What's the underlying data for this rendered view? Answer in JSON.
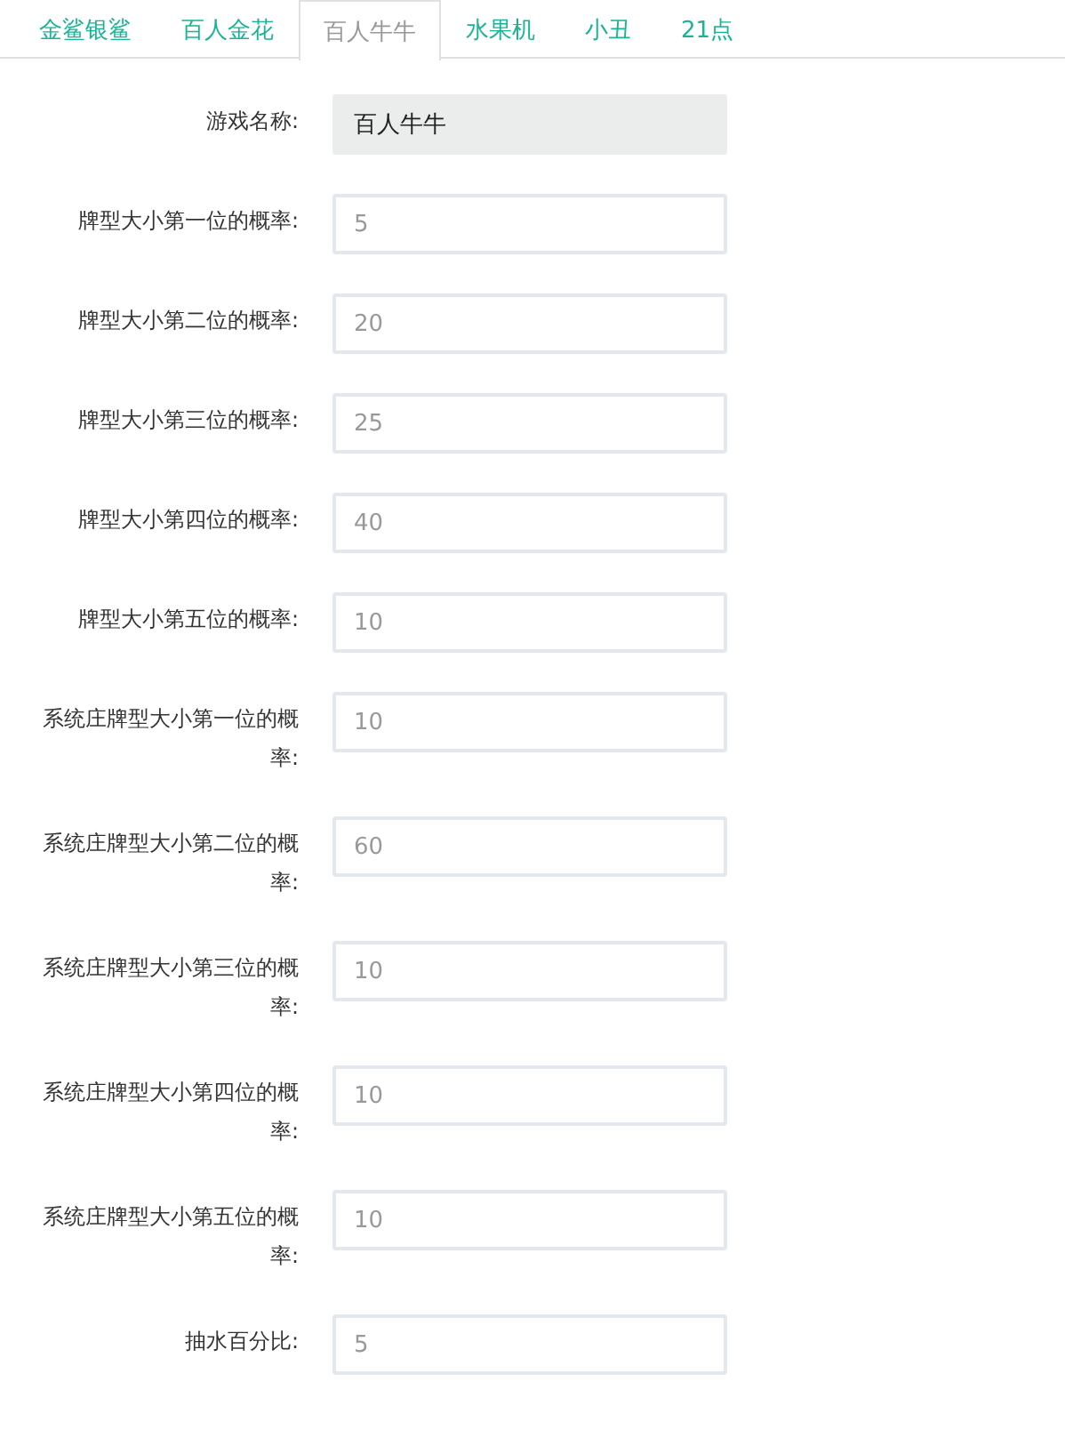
{
  "tabs": [
    {
      "label": "金鲨银鲨",
      "selected": false
    },
    {
      "label": "百人金花",
      "selected": false
    },
    {
      "label": "百人牛牛",
      "selected": true
    },
    {
      "label": "水果机",
      "selected": false
    },
    {
      "label": "小丑",
      "selected": false
    },
    {
      "label": "21点",
      "selected": false
    }
  ],
  "fields": [
    {
      "label": "游戏名称:",
      "value": "百人牛牛",
      "disabled": true
    },
    {
      "label": "牌型大小第一位的概率:",
      "placeholder": "5",
      "disabled": false
    },
    {
      "label": "牌型大小第二位的概率:",
      "placeholder": "20",
      "disabled": false
    },
    {
      "label": "牌型大小第三位的概率:",
      "placeholder": "25",
      "disabled": false
    },
    {
      "label": "牌型大小第四位的概率:",
      "placeholder": "40",
      "disabled": false
    },
    {
      "label": "牌型大小第五位的概率:",
      "placeholder": "10",
      "disabled": false
    },
    {
      "label": "系统庄牌型大小第一位的概率:",
      "placeholder": "10",
      "disabled": false
    },
    {
      "label": "系统庄牌型大小第二位的概率:",
      "placeholder": "60",
      "disabled": false
    },
    {
      "label": "系统庄牌型大小第三位的概率:",
      "placeholder": "10",
      "disabled": false
    },
    {
      "label": "系统庄牌型大小第四位的概率:",
      "placeholder": "10",
      "disabled": false
    },
    {
      "label": "系统庄牌型大小第五位的概率:",
      "placeholder": "10",
      "disabled": false
    },
    {
      "label": "抽水百分比:",
      "placeholder": "5",
      "disabled": false
    }
  ]
}
